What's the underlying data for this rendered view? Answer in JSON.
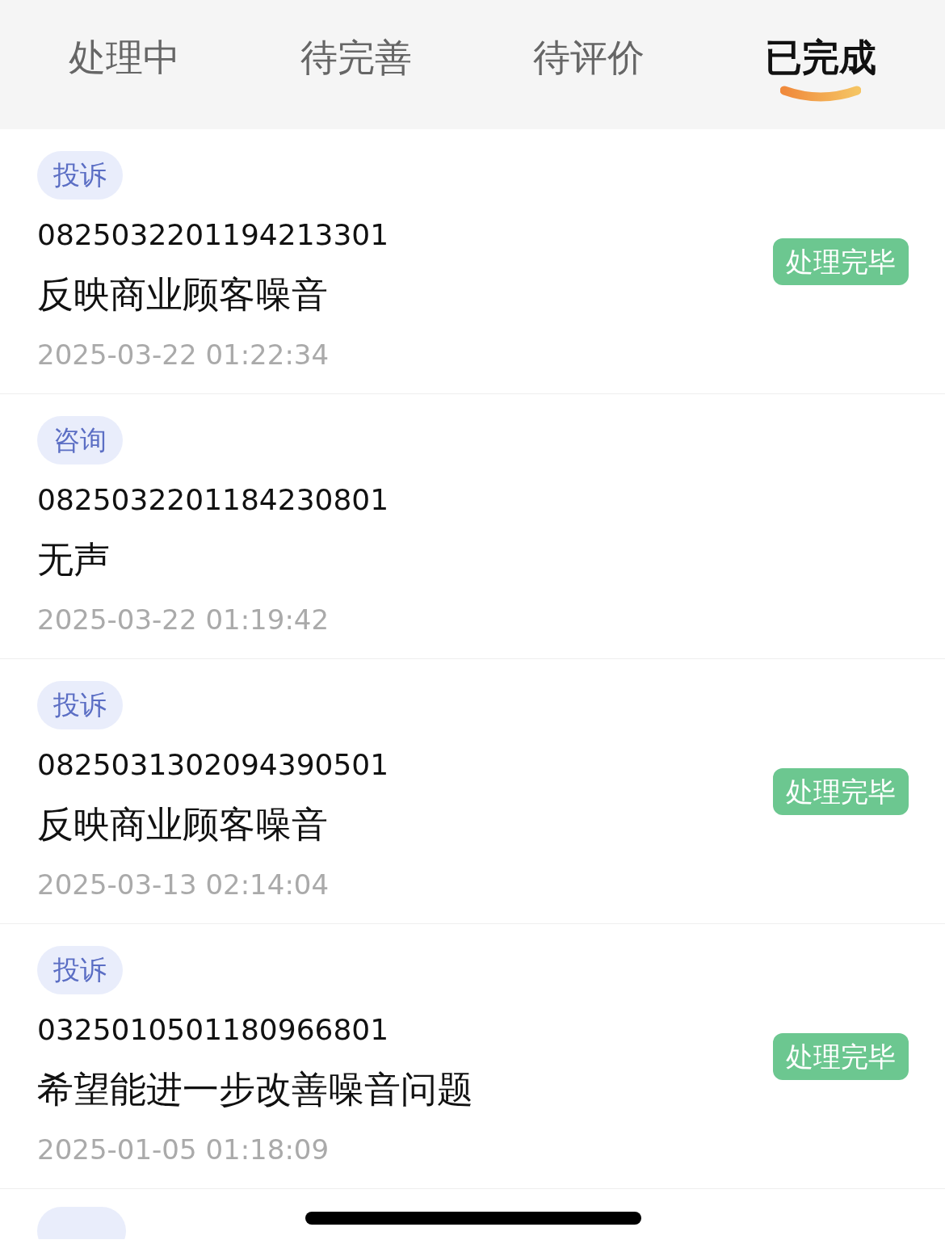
{
  "tabs": [
    {
      "label": "处理中",
      "selected": false
    },
    {
      "label": "待完善",
      "selected": false
    },
    {
      "label": "待评价",
      "selected": false
    },
    {
      "label": "已完成",
      "selected": true
    }
  ],
  "tickets": [
    {
      "tag": "投诉",
      "number": "0825032201194213301",
      "title": "反映商业顾客噪音",
      "time": "2025-03-22 01:22:34",
      "status": "处理完毕"
    },
    {
      "tag": "咨询",
      "number": "0825032201184230801",
      "title": "无声",
      "time": "2025-03-22 01:19:42"
    },
    {
      "tag": "投诉",
      "number": "0825031302094390501",
      "title": "反映商业顾客噪音",
      "time": "2025-03-13 02:14:04",
      "status": "处理完毕"
    },
    {
      "tag": "投诉",
      "number": "0325010501180966801",
      "title": "希望能进一步改善噪音问题",
      "time": "2025-01-05 01:18:09",
      "status": "处理完毕"
    }
  ]
}
